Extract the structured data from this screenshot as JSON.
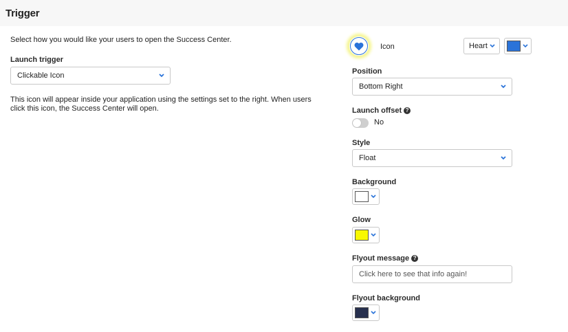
{
  "header": {
    "title": "Trigger"
  },
  "left": {
    "intro": "Select how you would like your users to open the Success Center.",
    "launch_trigger_label": "Launch trigger",
    "launch_trigger_value": "Clickable Icon",
    "description": "This icon will appear inside your application using the settings set to the right. When users click this icon, the Success Center will open."
  },
  "right": {
    "icon_label": "Icon",
    "icon_name": "heart-icon",
    "icon_select_value": "Heart",
    "icon_color": "#2a73d9",
    "position_label": "Position",
    "position_value": "Bottom Right",
    "launch_offset_label": "Launch offset",
    "launch_offset_help": "?",
    "launch_offset_state": "No",
    "style_label": "Style",
    "style_value": "Float",
    "background_label": "Background",
    "background_color": "#ffffff",
    "glow_label": "Glow",
    "glow_color": "#f8f800",
    "flyout_message_label": "Flyout message",
    "flyout_message_help": "?",
    "flyout_message_placeholder": "Click here to see that info again!",
    "flyout_background_label": "Flyout background",
    "flyout_background_color": "#262f4d"
  },
  "colors": {
    "accent": "#2a73d9",
    "chevron": "#2a73d9"
  }
}
